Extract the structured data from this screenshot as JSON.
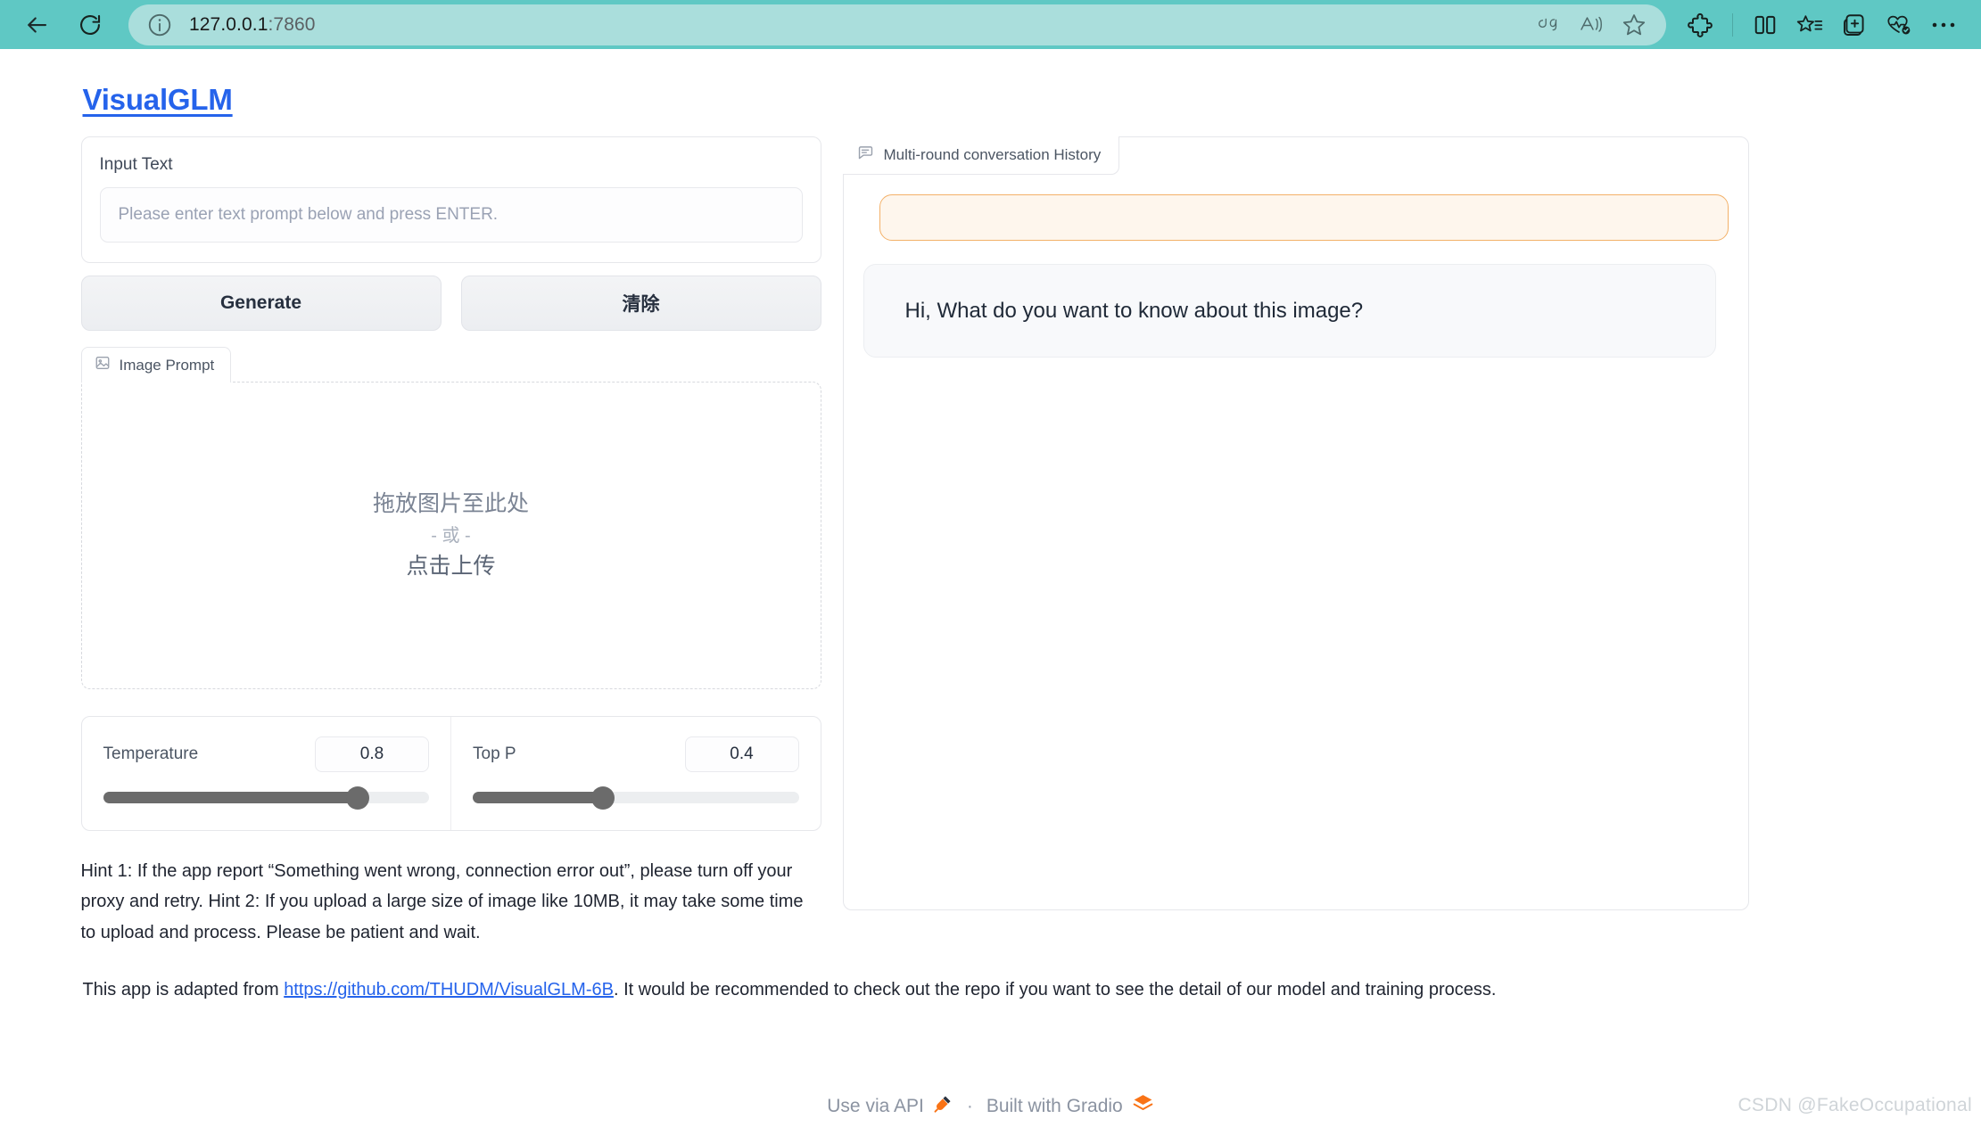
{
  "browser": {
    "back_label": "Back",
    "reload_label": "Refresh",
    "url": "127.0.0.1:7860",
    "url_host": "127.0.0.1",
    "url_port": ":7860",
    "chrome_color": "#5fc8c4",
    "address_pill_color": "#aadedc",
    "address_actions": [
      "translate-icon",
      "read-aloud-icon",
      "favorite-star-icon"
    ],
    "toolbar_actions": [
      "extensions-icon",
      "split-screen-icon",
      "collections-icon",
      "add-to-collection-icon",
      "browser-essentials-icon",
      "more-options-icon"
    ]
  },
  "app": {
    "title": "VisualGLM",
    "title_color": "#2563eb"
  },
  "input": {
    "label": "Input Text",
    "placeholder": "Please enter text prompt below and press ENTER.",
    "value": ""
  },
  "buttons": {
    "generate": "Generate",
    "clear": "清除"
  },
  "image_prompt": {
    "tab_label": "Image Prompt",
    "tab_icon": "image-icon",
    "drop_line1": "拖放图片至此处",
    "drop_line2": "- 或 -",
    "drop_line3": "点击上传"
  },
  "sliders": [
    {
      "label": "Temperature",
      "value": "0.8",
      "percent": 78
    },
    {
      "label": "Top P",
      "value": "0.4",
      "percent": 40
    }
  ],
  "hint": "Hint 1: If the app report “Something went wrong, connection error out”, please turn off your proxy and retry. Hint 2: If you upload a large size of image like 10MB, it may take some time to upload and process. Please be patient and wait.",
  "chat": {
    "tab_label": "Multi-round conversation History",
    "tab_icon": "chat-bubble-icon",
    "user_message": "",
    "bot_message": "Hi, What do you want to know about this image?",
    "user_bubble_bg": "#fef6ed",
    "user_bubble_border": "#f3b169",
    "bot_bubble_bg": "#f8f9fb"
  },
  "footer": {
    "note_prefix": "This app is adapted from ",
    "note_link": "https://github.com/THUDM/VisualGLM-6B",
    "note_suffix": ". It would be recommended to check out the repo if you want to see the detail of our model and training process.",
    "use_via_api": "Use via API",
    "separator": "·",
    "built_with": "Built with Gradio"
  },
  "watermark": "CSDN @FakeOccupational"
}
